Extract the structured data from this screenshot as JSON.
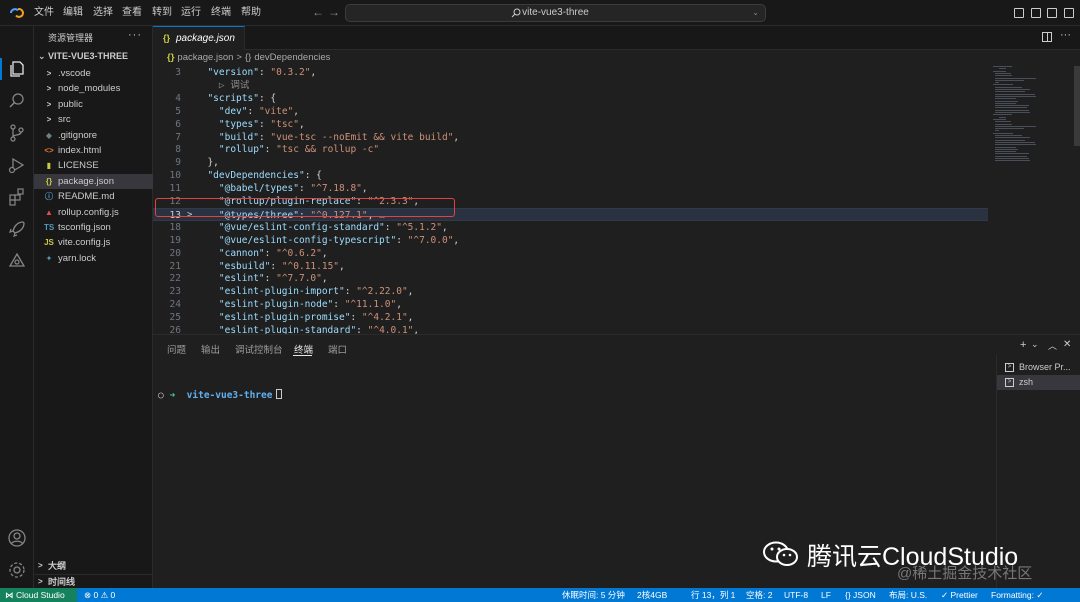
{
  "titlebar": {
    "menus": [
      "文件",
      "编辑",
      "选择",
      "查看",
      "转到",
      "运行",
      "终端",
      "帮助"
    ],
    "command_center": "vite-vue3-three"
  },
  "sidebar": {
    "title": "资源管理器",
    "more": "···",
    "project": "VITE-VUE3-THREE",
    "items": [
      {
        "label": ".vscode",
        "icon": ">",
        "color": "#cccccc"
      },
      {
        "label": "node_modules",
        "icon": ">",
        "color": "#cccccc"
      },
      {
        "label": "public",
        "icon": ">",
        "color": "#cccccc"
      },
      {
        "label": "src",
        "icon": ">",
        "color": "#cccccc"
      },
      {
        "label": ".gitignore",
        "icon": "◆",
        "color": "#6d8086"
      },
      {
        "label": "index.html",
        "icon": "<>",
        "color": "#e37933"
      },
      {
        "label": "LICENSE",
        "icon": "▮",
        "color": "#cbcb41"
      },
      {
        "label": "package.json",
        "icon": "{}",
        "color": "#cbcb41"
      },
      {
        "label": "README.md",
        "icon": "ⓘ",
        "color": "#519aba"
      },
      {
        "label": "rollup.config.js",
        "icon": "▲",
        "color": "#e44d4d"
      },
      {
        "label": "tsconfig.json",
        "icon": "TS",
        "color": "#519aba"
      },
      {
        "label": "vite.config.js",
        "icon": "JS",
        "color": "#cbcb41"
      },
      {
        "label": "yarn.lock",
        "icon": "✦",
        "color": "#519aba"
      }
    ],
    "outline": "大纲",
    "timeline": "时间线"
  },
  "editor": {
    "tab": {
      "label": "package.json",
      "icon": "{}"
    },
    "breadcrumb": [
      "package.json",
      "devDependencies"
    ],
    "breadcrumb_icons": [
      "{}",
      "{}"
    ],
    "codelens": "▷ 调试",
    "lines": [
      {
        "n": "3",
        "tokens": [
          [
            "  ",
            "p"
          ],
          [
            "\"version\"",
            "k"
          ],
          [
            ": ",
            "p"
          ],
          [
            "\"0.3.2\"",
            "s"
          ],
          [
            ",",
            "p"
          ]
        ]
      },
      {
        "n": "",
        "tokens": [
          [
            "    ▷ 调试",
            "cl"
          ]
        ]
      },
      {
        "n": "4",
        "tokens": [
          [
            "  ",
            "p"
          ],
          [
            "\"scripts\"",
            "k"
          ],
          [
            ": {",
            "p"
          ]
        ]
      },
      {
        "n": "5",
        "tokens": [
          [
            "    ",
            "p"
          ],
          [
            "\"dev\"",
            "k"
          ],
          [
            ": ",
            "p"
          ],
          [
            "\"vite\"",
            "s"
          ],
          [
            ",",
            "p"
          ]
        ]
      },
      {
        "n": "6",
        "tokens": [
          [
            "    ",
            "p"
          ],
          [
            "\"types\"",
            "k"
          ],
          [
            ": ",
            "p"
          ],
          [
            "\"tsc\"",
            "s"
          ],
          [
            ",",
            "p"
          ]
        ]
      },
      {
        "n": "7",
        "tokens": [
          [
            "    ",
            "p"
          ],
          [
            "\"build\"",
            "k"
          ],
          [
            ": ",
            "p"
          ],
          [
            "\"vue-tsc --noEmit && vite build\"",
            "s"
          ],
          [
            ",",
            "p"
          ]
        ]
      },
      {
        "n": "8",
        "tokens": [
          [
            "    ",
            "p"
          ],
          [
            "\"rollup\"",
            "k"
          ],
          [
            ": ",
            "p"
          ],
          [
            "\"tsc && rollup -c\"",
            "s"
          ]
        ]
      },
      {
        "n": "9",
        "tokens": [
          [
            "  },",
            "p"
          ]
        ]
      },
      {
        "n": "10",
        "tokens": [
          [
            "  ",
            "p"
          ],
          [
            "\"devDependencies\"",
            "k"
          ],
          [
            ": {",
            "p"
          ]
        ]
      },
      {
        "n": "11",
        "tokens": [
          [
            "    ",
            "p"
          ],
          [
            "\"@babel/types\"",
            "k"
          ],
          [
            ": ",
            "p"
          ],
          [
            "\"^7.18.8\"",
            "s"
          ],
          [
            ",",
            "p"
          ]
        ]
      },
      {
        "n": "12",
        "tokens": [
          [
            "    ",
            "p"
          ],
          [
            "\"@rollup/plugin-replace\"",
            "k"
          ],
          [
            ": ",
            "p"
          ],
          [
            "\"^2.3.3\"",
            "s"
          ],
          [
            ",",
            "p"
          ]
        ]
      },
      {
        "n": "13",
        "tokens": [
          [
            "    ",
            "p"
          ],
          [
            "\"@types/three\"",
            "k"
          ],
          [
            ": ",
            "p"
          ],
          [
            "\"^0.127.1\"",
            "s"
          ],
          [
            ",",
            "p"
          ],
          [
            " …",
            "cl"
          ]
        ],
        "hl": true
      },
      {
        "n": "18",
        "tokens": [
          [
            "    ",
            "p"
          ],
          [
            "\"@vue/eslint-config-standard\"",
            "k"
          ],
          [
            ": ",
            "p"
          ],
          [
            "\"^5.1.2\"",
            "s"
          ],
          [
            ",",
            "p"
          ]
        ]
      },
      {
        "n": "19",
        "tokens": [
          [
            "    ",
            "p"
          ],
          [
            "\"@vue/eslint-config-typescript\"",
            "k"
          ],
          [
            ": ",
            "p"
          ],
          [
            "\"^7.0.0\"",
            "s"
          ],
          [
            ",",
            "p"
          ]
        ]
      },
      {
        "n": "20",
        "tokens": [
          [
            "    ",
            "p"
          ],
          [
            "\"cannon\"",
            "k"
          ],
          [
            ": ",
            "p"
          ],
          [
            "\"^0.6.2\"",
            "s"
          ],
          [
            ",",
            "p"
          ]
        ]
      },
      {
        "n": "21",
        "tokens": [
          [
            "    ",
            "p"
          ],
          [
            "\"esbuild\"",
            "k"
          ],
          [
            ": ",
            "p"
          ],
          [
            "\"^0.11.15\"",
            "s"
          ],
          [
            ",",
            "p"
          ]
        ]
      },
      {
        "n": "22",
        "tokens": [
          [
            "    ",
            "p"
          ],
          [
            "\"eslint\"",
            "k"
          ],
          [
            ": ",
            "p"
          ],
          [
            "\"^7.7.0\"",
            "s"
          ],
          [
            ",",
            "p"
          ]
        ]
      },
      {
        "n": "23",
        "tokens": [
          [
            "    ",
            "p"
          ],
          [
            "\"eslint-plugin-import\"",
            "k"
          ],
          [
            ": ",
            "p"
          ],
          [
            "\"^2.22.0\"",
            "s"
          ],
          [
            ",",
            "p"
          ]
        ]
      },
      {
        "n": "24",
        "tokens": [
          [
            "    ",
            "p"
          ],
          [
            "\"eslint-plugin-node\"",
            "k"
          ],
          [
            ": ",
            "p"
          ],
          [
            "\"^11.1.0\"",
            "s"
          ],
          [
            ",",
            "p"
          ]
        ]
      },
      {
        "n": "25",
        "tokens": [
          [
            "    ",
            "p"
          ],
          [
            "\"eslint-plugin-promise\"",
            "k"
          ],
          [
            ": ",
            "p"
          ],
          [
            "\"^4.2.1\"",
            "s"
          ],
          [
            ",",
            "p"
          ]
        ]
      },
      {
        "n": "26",
        "tokens": [
          [
            "    ",
            "p"
          ],
          [
            "\"eslint-plugin-standard\"",
            "k"
          ],
          [
            ": ",
            "p"
          ],
          [
            "\"^4.0.1\"",
            "s"
          ],
          [
            ",",
            "p"
          ]
        ]
      }
    ],
    "highlight_color": "#e0443e"
  },
  "panel": {
    "tabs": [
      "问题",
      "输出",
      "调试控制台",
      "终端",
      "端口"
    ],
    "active_tab": "终端",
    "actions": [
      "+",
      "⌄",
      "︿",
      "✕"
    ],
    "terminal": {
      "circle": "○",
      "arrow": "➜",
      "directory": "vite-vue3-three"
    },
    "terminal_list": [
      {
        "label": "Browser Pr..."
      },
      {
        "label": "zsh"
      }
    ]
  },
  "watermark": {
    "title": "腾讯云CloudStudio",
    "subtitle": "@稀土掘金技术社区"
  },
  "statusbar": {
    "remote": "Cloud Studio",
    "problems": "⊗ 0 ⚠ 0",
    "items": [
      "休眠时间: 5 分钟",
      "2核4GB",
      "行 13，列 1",
      "空格: 2",
      "UTF-8",
      "LF",
      "{} JSON",
      "布局: U.S.",
      "✓ Prettier",
      "Formatting: ✓"
    ]
  },
  "colors": {
    "accent": "#0078d4",
    "remote": "#16825d"
  }
}
